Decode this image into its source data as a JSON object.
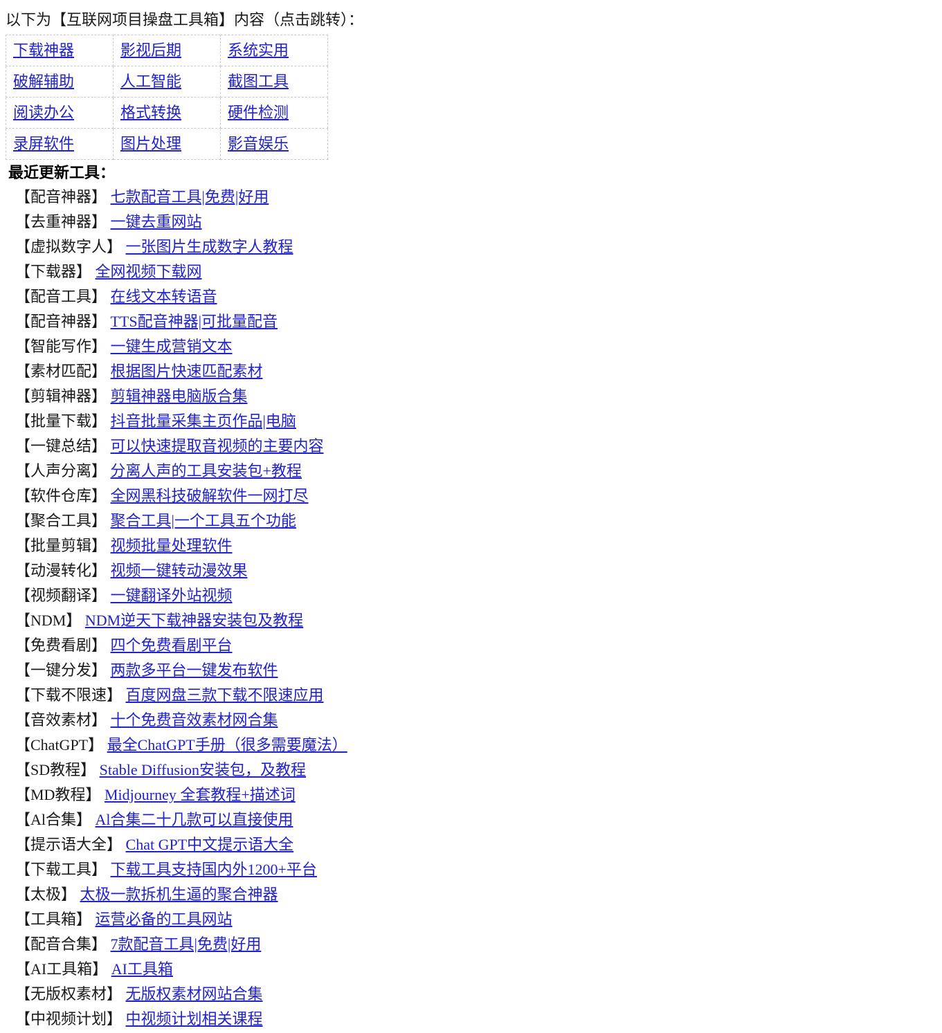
{
  "intro": {
    "text": "以下为【互联网项目操盘工具箱】内容（点击跳转）："
  },
  "nav_table": {
    "rows": [
      [
        {
          "label": "下载神器"
        },
        {
          "label": "影视后期"
        },
        {
          "label": "系统实用"
        }
      ],
      [
        {
          "label": "破解辅助"
        },
        {
          "label": "人工智能"
        },
        {
          "label": "截图工具"
        }
      ],
      [
        {
          "label": "阅读办公"
        },
        {
          "label": "格式转换"
        },
        {
          "label": "硬件检测"
        }
      ],
      [
        {
          "label": "录屏软件"
        },
        {
          "label": "图片处理"
        },
        {
          "label": "影音娱乐"
        }
      ]
    ]
  },
  "recent": {
    "heading": "最近更新工具：",
    "items": [
      {
        "tag": "【配音神器】",
        "link": "七款配音工具|免费|好用"
      },
      {
        "tag": "【去重神器】",
        "link": "一键去重网站"
      },
      {
        "tag": "【虚拟数字人】",
        "link": "一张图片生成数字人教程"
      },
      {
        "tag": "【下载器】",
        "link": "全网视频下载网"
      },
      {
        "tag": "【配音工具】",
        "link": "在线文本转语音"
      },
      {
        "tag": "【配音神器】",
        "link": "TTS配音神器|可批量配音"
      },
      {
        "tag": "【智能写作】",
        "link": "一键生成营销文本"
      },
      {
        "tag": "【素材匹配】",
        "link": "根据图片快速匹配素材"
      },
      {
        "tag": "【剪辑神器】",
        "link": "剪辑神器电脑版合集"
      },
      {
        "tag": "【批量下载】",
        "link": "抖音批量采集主页作品|电脑"
      },
      {
        "tag": "【一键总结】",
        "link": "可以快速提取音视频的主要内容"
      },
      {
        "tag": "【人声分离】",
        "link": "分离人声的工具安装包+教程"
      },
      {
        "tag": "【软件仓库】",
        "link": "全网黑科技破解软件一网打尽"
      },
      {
        "tag": "【聚合工具】",
        "link": "聚合工具|一个工具五个功能"
      },
      {
        "tag": "【批量剪辑】",
        "link": "视频批量处理软件"
      },
      {
        "tag": "【动漫转化】",
        "link": "视频一键转动漫效果"
      },
      {
        "tag": "【视频翻译】",
        "link": "一键翻译外站视频"
      },
      {
        "tag": "【NDM】",
        "link": "NDM逆天下载神器安装包及教程"
      },
      {
        "tag": "【免费看剧】",
        "link": "四个免费看剧平台"
      },
      {
        "tag": "【一键分发】",
        "link": "两款多平台一键发布软件"
      },
      {
        "tag": "【下载不限速】",
        "link": "百度网盘三款下载不限速应用"
      },
      {
        "tag": "【音效素材】",
        "link": "十个免费音效素材网合集"
      },
      {
        "tag": "【ChatGPT】",
        "link": "最全ChatGPT手册（很多需要魔法）"
      },
      {
        "tag": "【SD教程】",
        "link": "Stable Diffusion安装包，及教程"
      },
      {
        "tag": "【MD教程】",
        "link": "Midjourney 全套教程+描述词"
      },
      {
        "tag": "【Al合集】",
        "link": "Al合集二十几款可以直接使用"
      },
      {
        "tag": "【提示语大全】",
        "link": "Chat GPT中文提示语大全"
      },
      {
        "tag": "【下载工具】",
        "link": "下载工具支持国内外1200+平台"
      },
      {
        "tag": "【太极】",
        "link": "太极一款拆机生逼的聚合神器"
      },
      {
        "tag": "【工具箱】",
        "link": "运营必备的工具网站"
      },
      {
        "tag": "【配音合集】",
        "link": "7款配音工具|免费|好用"
      },
      {
        "tag": "【AI工具箱】",
        "link": "AI工具箱"
      },
      {
        "tag": "【无版权素材】",
        "link": "无版权素材网站合集"
      },
      {
        "tag": "【中视频计划】",
        "link": "中视频计划相关课程"
      }
    ]
  },
  "colors": {
    "link": "#2222cc",
    "text": "#1a1a1a",
    "table_border": "#c9c9c9",
    "background": "#ffffff"
  }
}
